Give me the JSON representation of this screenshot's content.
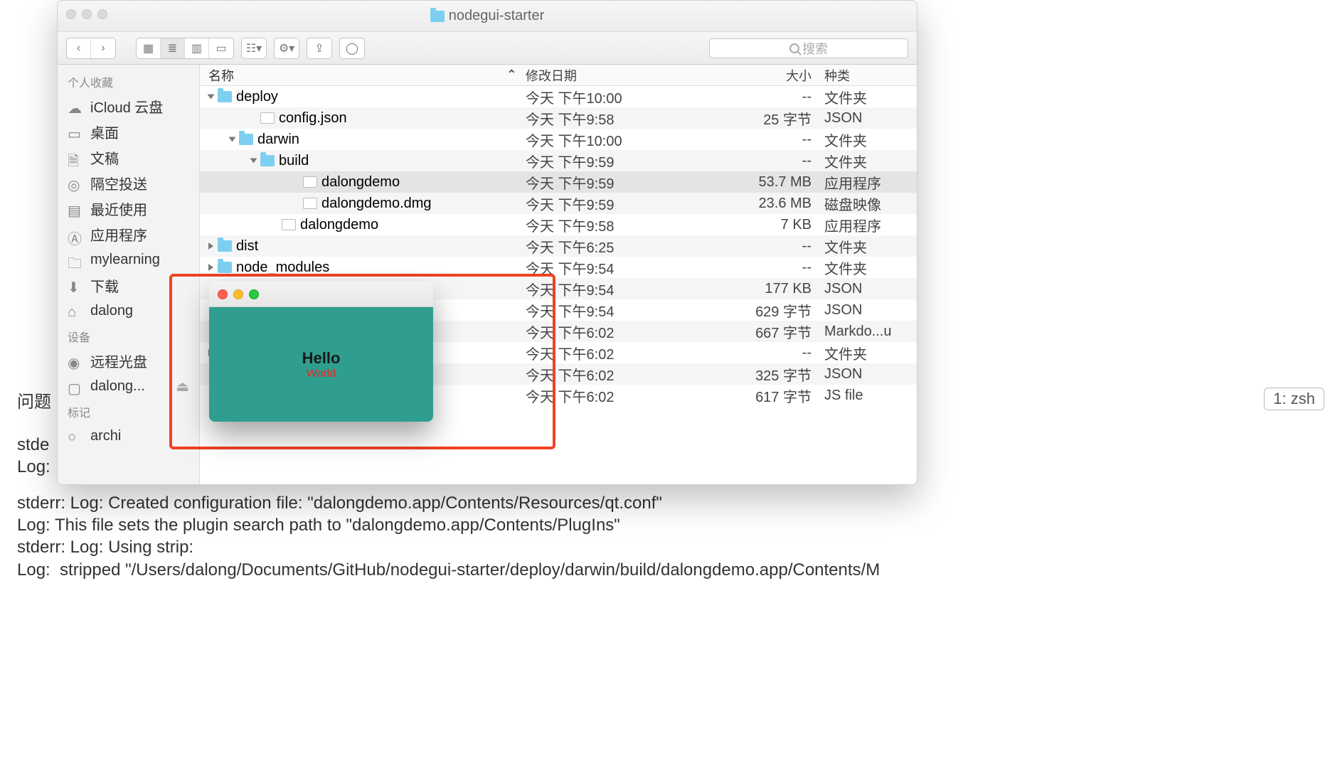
{
  "finder": {
    "title": "nodegui-starter",
    "search_placeholder": "搜索",
    "sidebar": {
      "section_favorites": "个人收藏",
      "items": [
        {
          "label": "iCloud 云盘",
          "icon": "cloud-icon"
        },
        {
          "label": "桌面",
          "icon": "desktop-icon"
        },
        {
          "label": "文稿",
          "icon": "documents-icon"
        },
        {
          "label": "隔空投送",
          "icon": "airdrop-icon"
        },
        {
          "label": "最近使用",
          "icon": "recents-icon"
        },
        {
          "label": "应用程序",
          "icon": "applications-icon"
        },
        {
          "label": "mylearning",
          "icon": "folder-icon"
        },
        {
          "label": "下载",
          "icon": "downloads-icon"
        },
        {
          "label": "dalong",
          "icon": "home-icon"
        }
      ],
      "section_devices": "设备",
      "devices": [
        {
          "label": "远程光盘",
          "icon": "disc-icon"
        },
        {
          "label": "dalong...",
          "icon": "disk-icon"
        }
      ],
      "section_tags": "标记",
      "tags": [
        {
          "label": "archi",
          "icon": "tag-icon"
        }
      ]
    },
    "columns": {
      "name": "名称",
      "date": "修改日期",
      "size": "大小",
      "kind": "种类"
    },
    "rows": [
      {
        "name": "deploy",
        "date": "今天 下午10:00",
        "size": "--",
        "kind": "文件夹",
        "icon": "folder",
        "indent": 0,
        "tri": "down",
        "sel": false
      },
      {
        "name": "config.json",
        "date": "今天 下午9:58",
        "size": "25 字节",
        "kind": "JSON",
        "icon": "file",
        "indent": 2,
        "tri": "none",
        "sel": false
      },
      {
        "name": "darwin",
        "date": "今天 下午10:00",
        "size": "--",
        "kind": "文件夹",
        "icon": "folder",
        "indent": 1,
        "tri": "down",
        "sel": false
      },
      {
        "name": "build",
        "date": "今天 下午9:59",
        "size": "--",
        "kind": "文件夹",
        "icon": "folder",
        "indent": 2,
        "tri": "down",
        "sel": false
      },
      {
        "name": "dalongdemo",
        "date": "今天 下午9:59",
        "size": "53.7 MB",
        "kind": "应用程序",
        "icon": "app",
        "indent": 4,
        "tri": "none",
        "sel": true
      },
      {
        "name": "dalongdemo.dmg",
        "date": "今天 下午9:59",
        "size": "23.6 MB",
        "kind": "磁盘映像",
        "icon": "dmg",
        "indent": 4,
        "tri": "none",
        "sel": false
      },
      {
        "name": "dalongdemo",
        "date": "今天 下午9:58",
        "size": "7 KB",
        "kind": "应用程序",
        "icon": "app",
        "indent": 3,
        "tri": "none",
        "sel": false
      },
      {
        "name": "dist",
        "date": "今天 下午6:25",
        "size": "--",
        "kind": "文件夹",
        "icon": "folder",
        "indent": 0,
        "tri": "right",
        "sel": false
      },
      {
        "name": "node_modules",
        "date": "今天 下午9:54",
        "size": "--",
        "kind": "文件夹",
        "icon": "folder",
        "indent": 0,
        "tri": "right",
        "sel": false
      },
      {
        "name": "",
        "date": "今天 下午9:54",
        "size": "177 KB",
        "kind": "JSON",
        "icon": "file",
        "indent": 0,
        "tri": "none",
        "sel": false
      },
      {
        "name": "",
        "date": "今天 下午9:54",
        "size": "629 字节",
        "kind": "JSON",
        "icon": "file",
        "indent": 0,
        "tri": "none",
        "sel": false
      },
      {
        "name": "",
        "date": "今天 下午6:02",
        "size": "667 字节",
        "kind": "Markdo...u",
        "icon": "file",
        "indent": 0,
        "tri": "none",
        "sel": false
      },
      {
        "name": "",
        "date": "今天 下午6:02",
        "size": "--",
        "kind": "文件夹",
        "icon": "folder",
        "indent": 0,
        "tri": "right",
        "sel": false
      },
      {
        "name": "",
        "date": "今天 下午6:02",
        "size": "325 字节",
        "kind": "JSON",
        "icon": "file",
        "indent": 0,
        "tri": "none",
        "sel": false
      },
      {
        "name": "",
        "date": "今天 下午6:02",
        "size": "617 字节",
        "kind": "JS file",
        "icon": "file",
        "indent": 0,
        "tri": "none",
        "sel": false
      }
    ]
  },
  "appwin": {
    "hello": "Hello",
    "world": "World"
  },
  "terminal": {
    "tab": "1: zsh",
    "left_tab": "问题",
    "line_stde": "stde",
    "line_log": "Log:",
    "line1": "stderr: Log: Created configuration file: \"dalongdemo.app/Contents/Resources/qt.conf\"",
    "line2": "Log: This file sets the plugin search path to \"dalongdemo.app/Contents/PlugIns\"",
    "line3": "",
    "line4": "stderr: Log: Using strip:",
    "line5": "Log:  stripped \"/Users/dalong/Documents/GitHub/nodegui-starter/deploy/darwin/build/dalongdemo.app/Contents/M"
  }
}
